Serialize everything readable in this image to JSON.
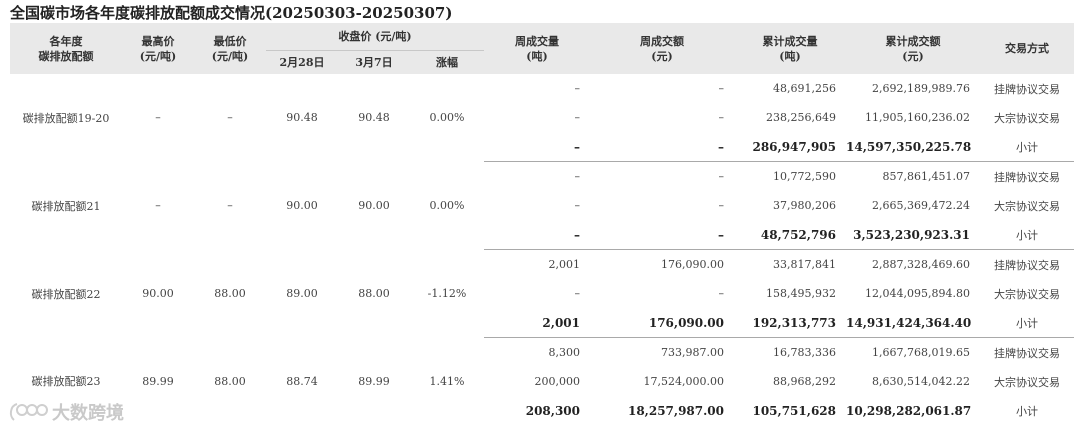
{
  "title": "全国碳市场各年度碳排放配额成交情况(20250303-20250307)",
  "headers": {
    "year": "各年度\n碳排放配额",
    "high": "最高价\n(元/吨)",
    "low": "最低价\n(元/吨)",
    "close": "收盘价 (元/吨)",
    "feb28": "2月28日",
    "mar7": "3月7日",
    "change": "涨幅",
    "week_vol": "周成交量\n(吨)",
    "week_amt": "周成交额\n(元)",
    "cum_vol": "累计成交量\n(吨)",
    "cum_amt": "累计成交额\n(元)",
    "method": "交易方式"
  },
  "groups": [
    {
      "name": "碳排放配额19-20",
      "high": "–",
      "low": "–",
      "feb28": "90.48",
      "mar7": "90.48",
      "change": "0.00%",
      "rows": [
        {
          "week_vol": "–",
          "week_amt": "–",
          "cum_vol": "48,691,256",
          "cum_amt": "2,692,189,989.76",
          "method": "挂牌协议交易"
        },
        {
          "week_vol": "–",
          "week_amt": "–",
          "cum_vol": "238,256,649",
          "cum_amt": "11,905,160,236.02",
          "method": "大宗协议交易"
        },
        {
          "week_vol": "–",
          "week_amt": "–",
          "cum_vol": "286,947,905",
          "cum_amt": "14,597,350,225.78",
          "method": "小计"
        }
      ]
    },
    {
      "name": "碳排放配额21",
      "high": "–",
      "low": "–",
      "feb28": "90.00",
      "mar7": "90.00",
      "change": "0.00%",
      "rows": [
        {
          "week_vol": "–",
          "week_amt": "–",
          "cum_vol": "10,772,590",
          "cum_amt": "857,861,451.07",
          "method": "挂牌协议交易"
        },
        {
          "week_vol": "–",
          "week_amt": "–",
          "cum_vol": "37,980,206",
          "cum_amt": "2,665,369,472.24",
          "method": "大宗协议交易"
        },
        {
          "week_vol": "–",
          "week_amt": "–",
          "cum_vol": "48,752,796",
          "cum_amt": "3,523,230,923.31",
          "method": "小计"
        }
      ]
    },
    {
      "name": "碳排放配额22",
      "high": "90.00",
      "low": "88.00",
      "feb28": "89.00",
      "mar7": "88.00",
      "change": "-1.12%",
      "rows": [
        {
          "week_vol": "2,001",
          "week_amt": "176,090.00",
          "cum_vol": "33,817,841",
          "cum_amt": "2,887,328,469.60",
          "method": "挂牌协议交易"
        },
        {
          "week_vol": "–",
          "week_amt": "–",
          "cum_vol": "158,495,932",
          "cum_amt": "12,044,095,894.80",
          "method": "大宗协议交易"
        },
        {
          "week_vol": "2,001",
          "week_amt": "176,090.00",
          "cum_vol": "192,313,773",
          "cum_amt": "14,931,424,364.40",
          "method": "小计"
        }
      ]
    },
    {
      "name": "碳排放配额23",
      "high": "89.99",
      "low": "88.00",
      "feb28": "88.74",
      "mar7": "89.99",
      "change": "1.41%",
      "rows": [
        {
          "week_vol": "8,300",
          "week_amt": "733,987.00",
          "cum_vol": "16,783,336",
          "cum_amt": "1,667,768,019.65",
          "method": "挂牌协议交易"
        },
        {
          "week_vol": "200,000",
          "week_amt": "17,524,000.00",
          "cum_vol": "88,968,292",
          "cum_amt": "8,630,514,042.22",
          "method": "大宗协议交易"
        },
        {
          "week_vol": "208,300",
          "week_amt": "18,257,987.00",
          "cum_vol": "105,751,628",
          "cum_amt": "10,298,282,061.87",
          "method": "小计"
        }
      ]
    }
  ],
  "watermark": "大数跨境",
  "watermark_icon": "logo-icon"
}
